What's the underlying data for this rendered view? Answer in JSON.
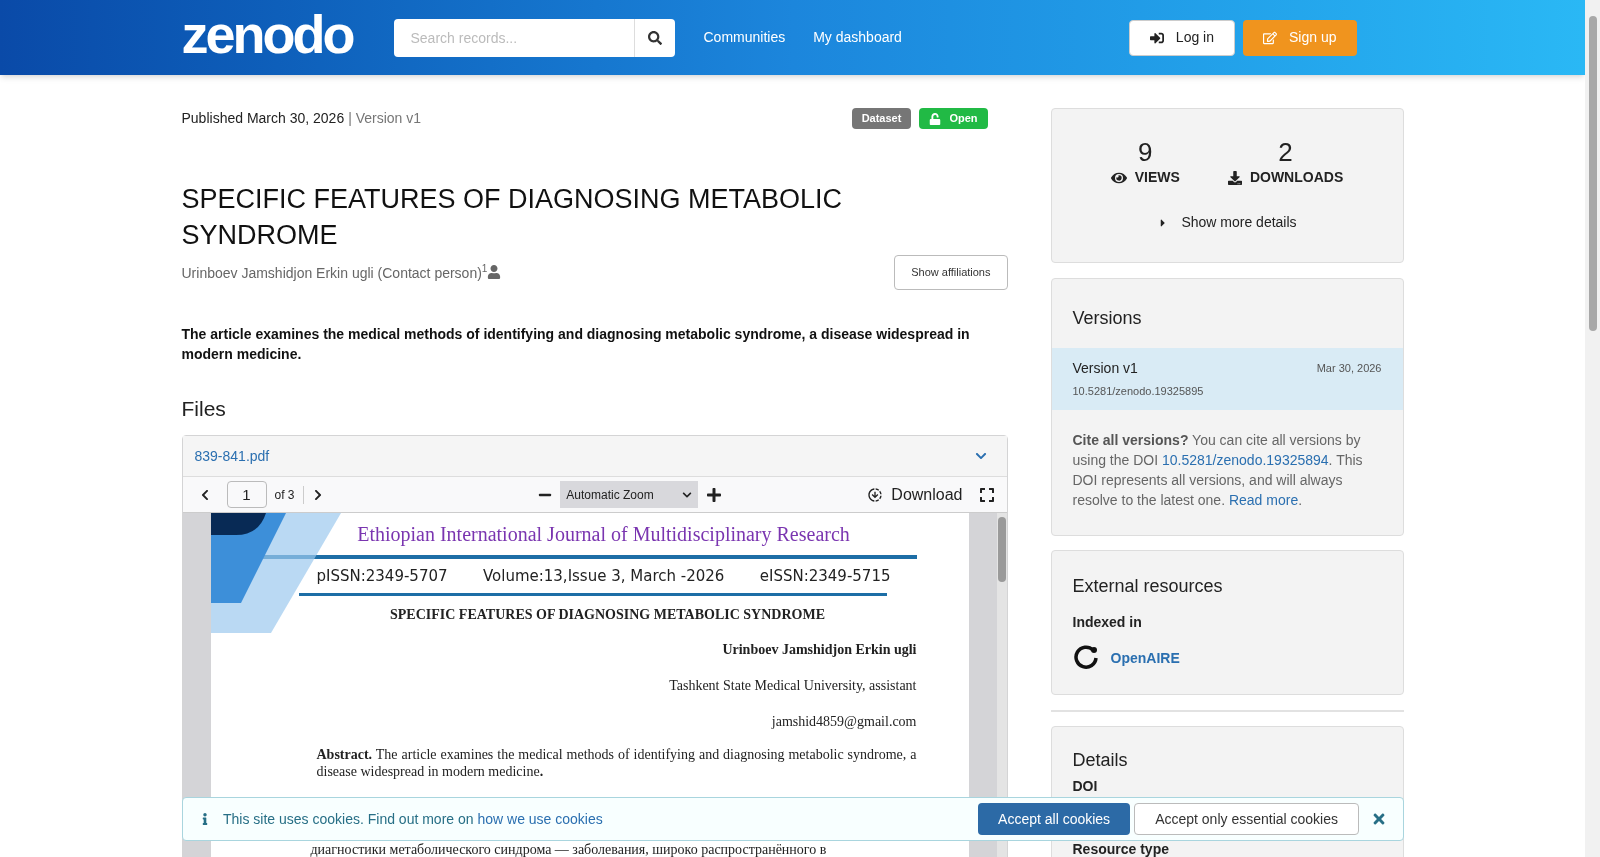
{
  "header": {
    "logo": "zenodo",
    "search": {
      "placeholder": "Search records..."
    },
    "nav": [
      "Communities",
      "My dashboard"
    ],
    "login": "Log in",
    "signup": "Sign up"
  },
  "record": {
    "published": "Published March 30, 2026",
    "version": "| Version v1",
    "badges": [
      {
        "label": "Dataset",
        "kind": "type"
      },
      {
        "label": "Open",
        "kind": "access"
      }
    ],
    "title": "SPECIFIC FEATURES OF DIAGNOSING METABOLIC SYNDROME",
    "creator": "Urinboev Jamshidjon Erkin ugli (Contact person)",
    "creator_sup": "1",
    "show_affiliations": "Show affiliations",
    "description": "The article examines the medical methods of identifying and diagnosing metabolic syndrome, a disease widespread in modern medicine."
  },
  "files": {
    "heading": "Files",
    "file_name": "839-841.pdf",
    "expanded": true,
    "viewer": {
      "page": "1",
      "of": "of 3",
      "zoom": "Automatic Zoom",
      "download": "Download",
      "page_content": {
        "journal": "Ethiopian International Journal of Multidisciplinary Research",
        "pissn": "pISSN:2349-5707",
        "volume": "Volume:13,Issue 3, March -2026",
        "eissn": "eISSN:2349-5715",
        "title": "SPECIFIC FEATURES OF DIAGNOSING METABOLIC SYNDROME",
        "author": "Urinboev Jamshidjon Erkin ugli",
        "affiliation": "Tashkent State Medical University,  assistant",
        "email": "jamshid4859@gmail.com",
        "abstract": "**Abstract.** The article examines the medical methods of identifying and diagnosing metabolic syndrome, a disease widespread in modern medicine**.**",
        "russian_line": "диагностики метаболического синдрома — заболевания, широко распространённого в"
      }
    }
  },
  "sidebar": {
    "stats": [
      {
        "value": "9",
        "label": "VIEWS",
        "kind": "views"
      },
      {
        "value": "2",
        "label": "DOWNLOADS",
        "kind": "downloads"
      }
    ],
    "show_more": "Show more details",
    "versions": {
      "heading": "Versions",
      "items": [
        {
          "label": "Version v1",
          "date": "Mar 30, 2026",
          "doi": "10.5281/zenodo.19325895",
          "selected": true
        }
      ],
      "cite": {
        "bold": "Cite all versions?",
        "text1": " You can cite all versions by using the DOI ",
        "doi": "10.5281/zenodo.19325894",
        "text2": ". This DOI represents all versions, and will always resolve to the latest one. ",
        "read_more": "Read more",
        "period": "."
      }
    },
    "external": {
      "heading": "External resources",
      "indexed": "Indexed in",
      "items": [
        "OpenAIRE"
      ]
    },
    "details": {
      "heading": "Details",
      "fields": [
        "DOI",
        "Resource type"
      ]
    }
  },
  "cookies": {
    "text": "This site uses cookies. Find out more on ",
    "link": "how we use cookies",
    "accept_all": "Accept all cookies",
    "accept_essential": "Accept only essential cookies"
  }
}
